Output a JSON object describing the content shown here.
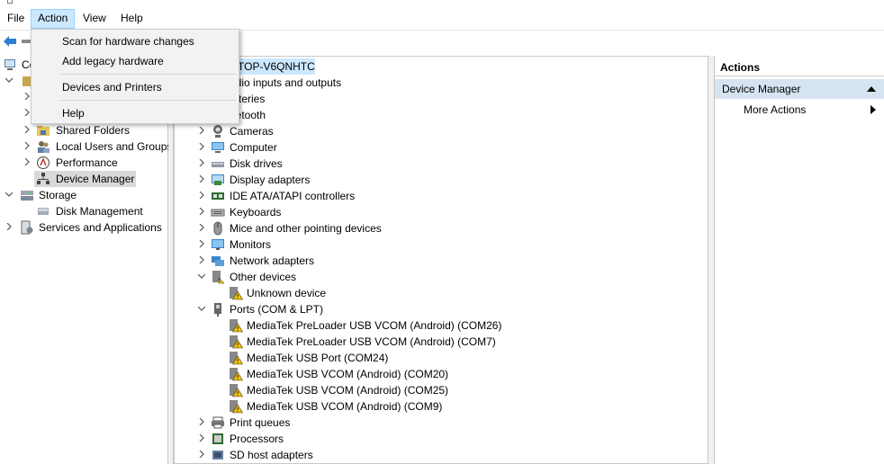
{
  "window": {
    "title": ""
  },
  "menubar": {
    "items": [
      "File",
      "Action",
      "View",
      "Help"
    ],
    "open_menu": "Action"
  },
  "action_menu": {
    "items": [
      "Scan for hardware changes",
      "Add legacy hardware",
      "Devices and Printers",
      "Help"
    ]
  },
  "left_tree": {
    "root_fragment": "Co",
    "items": [
      {
        "label": "Shared Folders",
        "icon": "shared-folder-icon"
      },
      {
        "label": "Local Users and Groups",
        "icon": "users-icon"
      },
      {
        "label": "Performance",
        "icon": "performance-icon"
      },
      {
        "label": "Device Manager",
        "icon": "device-manager-icon",
        "selected": true
      },
      {
        "label": "Storage",
        "icon": "storage-icon"
      },
      {
        "label": "Disk Management",
        "icon": "disk-management-icon"
      },
      {
        "label": "Services and Applications",
        "icon": "services-icon"
      }
    ]
  },
  "device_tree": {
    "computer_fragment": "TOP-V6QNHTC",
    "categories": [
      {
        "label": "udio inputs and outputs",
        "icon": "audio-icon"
      },
      {
        "label": "atteries",
        "icon": "battery-icon"
      },
      {
        "label": "uetooth",
        "icon": "bluetooth-icon"
      },
      {
        "label": "Cameras",
        "icon": "camera-icon"
      },
      {
        "label": "Computer",
        "icon": "computer-icon"
      },
      {
        "label": "Disk drives",
        "icon": "disk-icon"
      },
      {
        "label": "Display adapters",
        "icon": "display-adapter-icon"
      },
      {
        "label": "IDE ATA/ATAPI controllers",
        "icon": "ide-controller-icon"
      },
      {
        "label": "Keyboards",
        "icon": "keyboard-icon"
      },
      {
        "label": "Mice and other pointing devices",
        "icon": "mouse-icon"
      },
      {
        "label": "Monitors",
        "icon": "monitor-icon"
      },
      {
        "label": "Network adapters",
        "icon": "network-icon"
      },
      {
        "label": "Other devices",
        "icon": "other-devices-icon",
        "expanded": true
      },
      {
        "label": "Unknown device",
        "icon": "warning-device-icon",
        "child": true
      },
      {
        "label": "Ports (COM & LPT)",
        "icon": "port-icon",
        "expanded": true
      },
      {
        "label": "MediaTek PreLoader USB VCOM (Android) (COM26)",
        "icon": "warning-device-icon",
        "child": true
      },
      {
        "label": "MediaTek PreLoader USB VCOM (Android) (COM7)",
        "icon": "warning-device-icon",
        "child": true
      },
      {
        "label": "MediaTek USB Port (COM24)",
        "icon": "warning-device-icon",
        "child": true
      },
      {
        "label": "MediaTek USB VCOM (Android) (COM20)",
        "icon": "warning-device-icon",
        "child": true
      },
      {
        "label": "MediaTek USB VCOM (Android) (COM25)",
        "icon": "warning-device-icon",
        "child": true
      },
      {
        "label": "MediaTek USB VCOM (Android) (COM9)",
        "icon": "warning-device-icon",
        "child": true
      },
      {
        "label": "Print queues",
        "icon": "printer-icon"
      },
      {
        "label": "Processors",
        "icon": "processor-icon"
      },
      {
        "label": "SD host adapters",
        "icon": "sd-adapter-icon"
      }
    ]
  },
  "actions_pane": {
    "header": "Actions",
    "section": "Device Manager",
    "more_actions": "More Actions"
  },
  "colors": {
    "selection": "#cce8ff",
    "section_bg": "#d6e4f2",
    "warning": "#f5c400"
  }
}
